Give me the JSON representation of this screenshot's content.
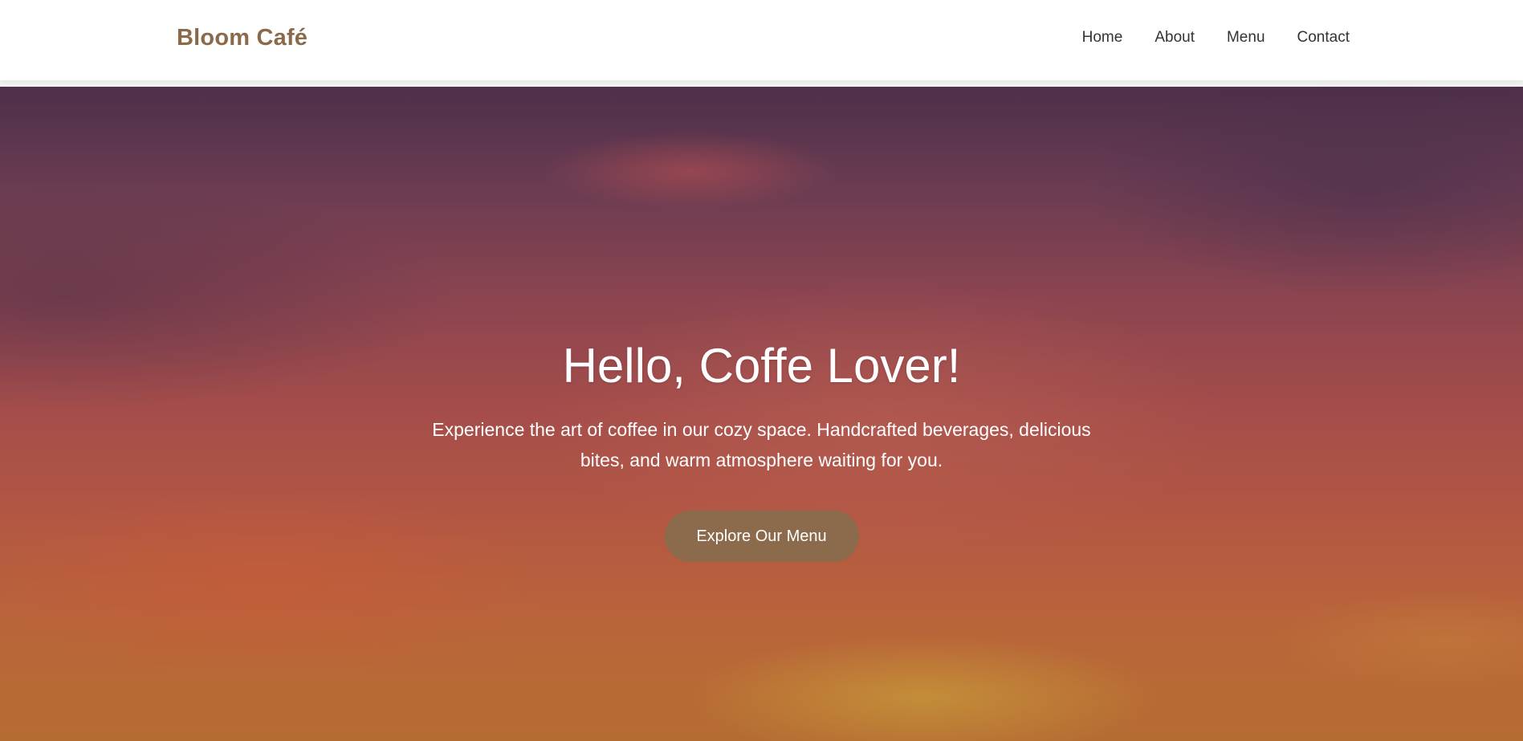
{
  "navbar": {
    "brand": "Bloom Café",
    "links": [
      {
        "label": "Home"
      },
      {
        "label": "About"
      },
      {
        "label": "Menu"
      },
      {
        "label": "Contact"
      }
    ]
  },
  "hero": {
    "title": "Hello, Coffe Lover!",
    "subtitle": "Experience the art of coffee in our cozy space. Handcrafted beverages, delicious bites, and warm atmosphere waiting for you.",
    "cta_label": "Explore Our Menu"
  },
  "colors": {
    "brand": "#8b6a4a",
    "button": "#8c6a4c",
    "nav_text": "#333333",
    "hero_text": "#ffffff"
  }
}
